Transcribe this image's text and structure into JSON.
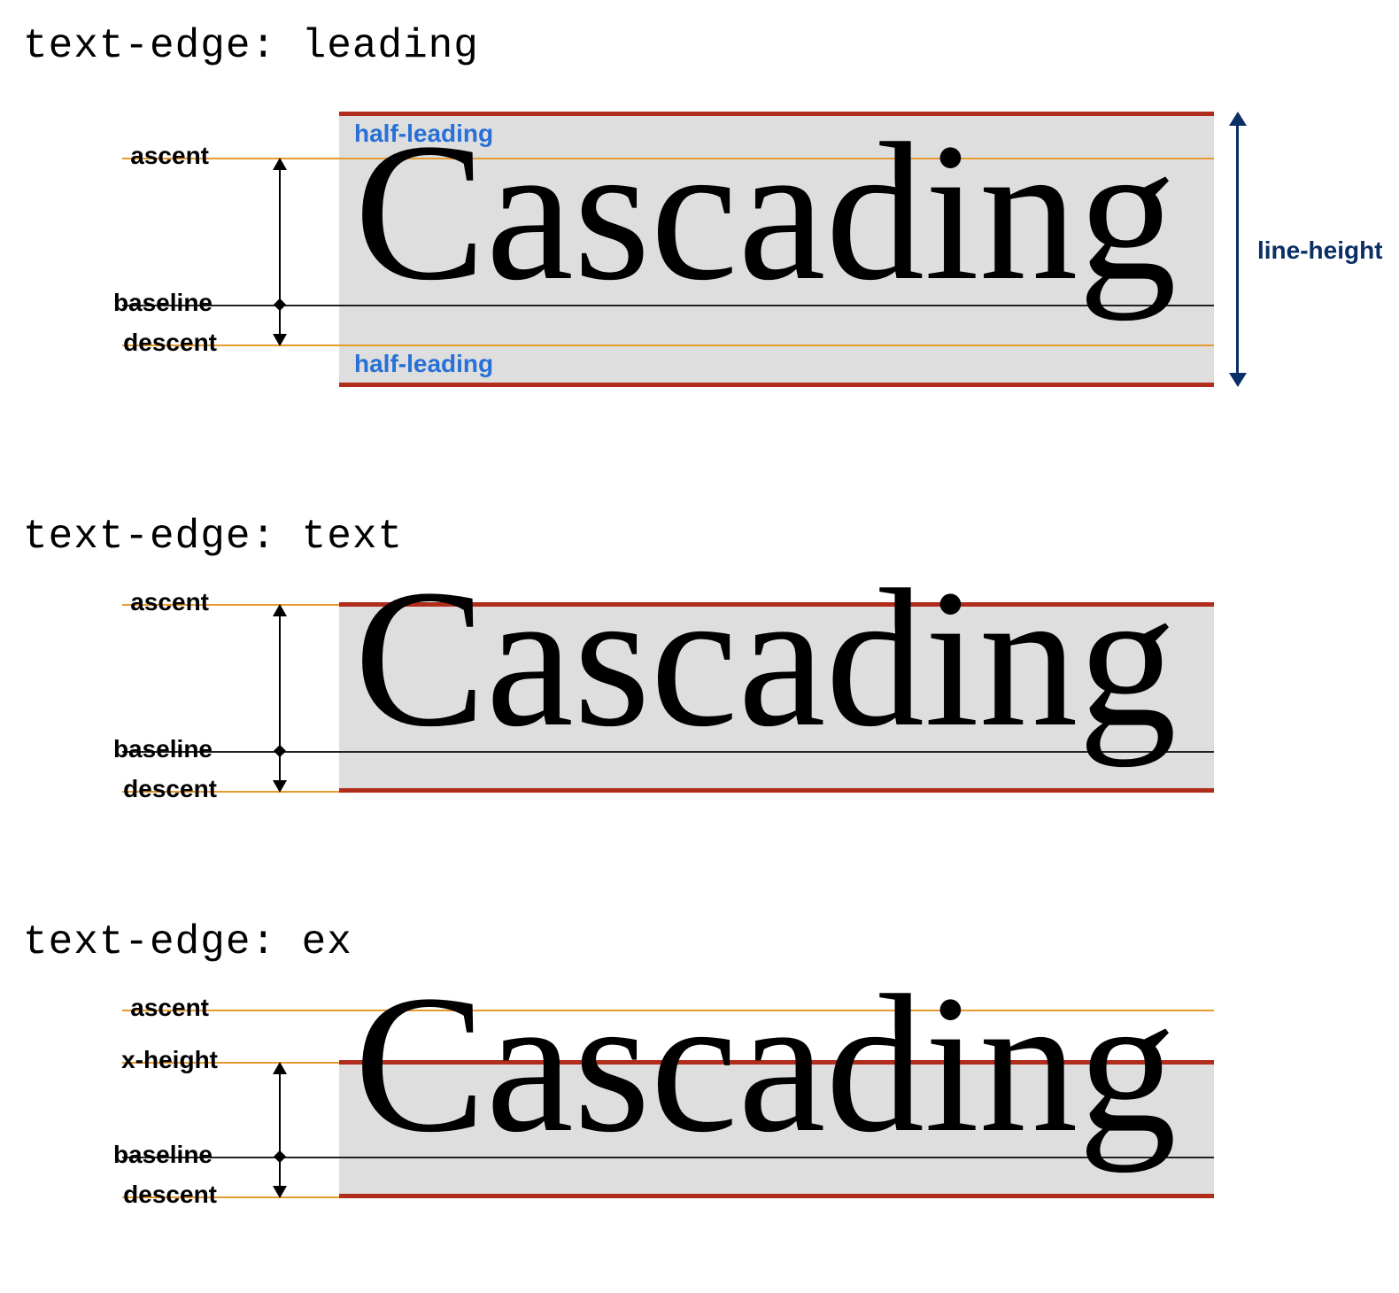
{
  "sections": [
    {
      "title": "text-edge: leading",
      "labels": {
        "ascent": "ascent",
        "baseline": "baseline",
        "descent": "descent",
        "half_leading": "half-leading",
        "line_height": "line-height"
      },
      "sample": "Cascading"
    },
    {
      "title": "text-edge: text",
      "labels": {
        "ascent": "ascent",
        "baseline": "baseline",
        "descent": "descent"
      },
      "sample": "Cascading"
    },
    {
      "title": "text-edge: ex",
      "labels": {
        "ascent": "ascent",
        "xheight": "x-height",
        "baseline": "baseline",
        "descent": "descent"
      },
      "sample": "Cascading"
    }
  ],
  "colors": {
    "gray": "#dedede",
    "red": "#b22c1c",
    "orange": "#e79a2f",
    "blue": "#2770d8",
    "navy": "#0a2f66"
  }
}
